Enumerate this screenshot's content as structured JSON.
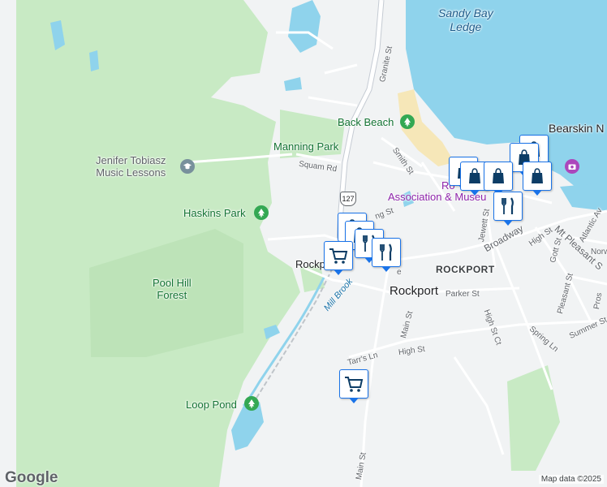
{
  "labels": {
    "sandy_bay_ledge": "Sandy Bay\nLedge",
    "bearskin_neck": "Bearskin N",
    "back_beach": "Back Beach",
    "manning_park": "Manning Park",
    "squam_rd": "Squam Rd",
    "jenifer": "Jenifer Tobiasz\nMusic Lessons",
    "haskins_park": "Haskins Park",
    "pool_hill": "Pool Hill\nForest",
    "loop_pond": "Loop Pond",
    "rockport_association": "Association & Museu",
    "rockport_assoc_top": "Ro",
    "rockport_partial": "Rockp",
    "rockport_town": "ROCKPORT",
    "rockport": "Rockport",
    "mill_brook": "Mill Brook",
    "granite_st": "Granite St",
    "smith_st": "Smith St",
    "main_st": "Main St",
    "main_st_south": "Main St",
    "parker_st": "Parker St",
    "high_st": "High St",
    "high_st_ct": "High St Ct",
    "tarrs_ln": "Tarr's Ln",
    "broadway": "Broadway",
    "jewett_st": "Jewett St",
    "mt_pleasant": "Mt Pleasant S",
    "pleasant_st": "Pleasant St",
    "gott_st": "Gott St",
    "atlantic_ave": "Atlantic Av",
    "high_st_east": "High St",
    "spring_ln": "Spring Ln",
    "summer_st": "Summer St",
    "king_st": "ng St",
    "e_suffix": "e",
    "norw": "Norw",
    "pros": "Pros",
    "route": "127"
  },
  "attribution": "Map data ©2025",
  "google_logo": "Google",
  "colors": {
    "water": "#8fd3ec",
    "park": "#c8eac4",
    "land": "#f1f3f4",
    "road": "#ffffff",
    "highway": "#c5cbd3",
    "marker_border": "#1a73e8",
    "marker_icon": "#0d3d66"
  }
}
